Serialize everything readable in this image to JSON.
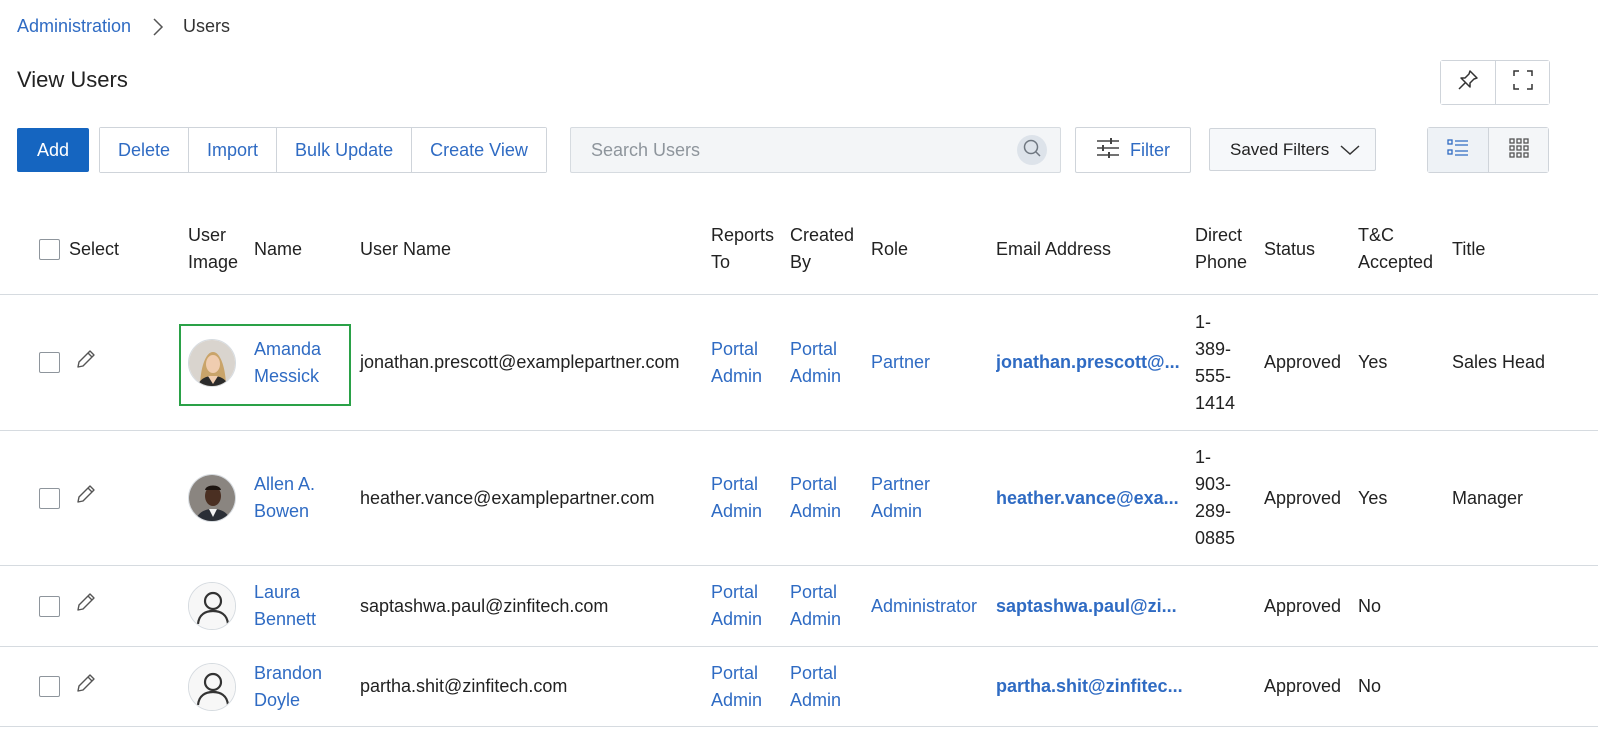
{
  "breadcrumb": {
    "parent": "Administration",
    "current": "Users"
  },
  "page_title": "View Users",
  "toolbar": {
    "add": "Add",
    "delete": "Delete",
    "import": "Import",
    "bulk_update": "Bulk Update",
    "create_view": "Create View",
    "search_placeholder": "Search Users",
    "filter": "Filter",
    "saved_filters": "Saved Filters"
  },
  "columns": {
    "select": "Select",
    "user_image_1": "User",
    "user_image_2": "Image",
    "name": "Name",
    "user_name": "User Name",
    "reports_to_1": "Reports",
    "reports_to_2": "To",
    "created_by_1": "Created",
    "created_by_2": "By",
    "role": "Role",
    "email": "Email Address",
    "direct_phone_1": "Direct",
    "direct_phone_2": "Phone",
    "status": "Status",
    "tc_1": "T&C",
    "tc_2": "Accepted",
    "title": "Title"
  },
  "rows": [
    {
      "first": "Amanda",
      "last": "Messick",
      "username": "jonathan.prescott@examplepartner.com",
      "reports_1": "Portal",
      "reports_2": "Admin",
      "created_1": "Portal",
      "created_2": "Admin",
      "role_1": "Partner",
      "role_2": "",
      "email": "jonathan.prescott@...",
      "phone_1": "1-",
      "phone_2": "389-",
      "phone_3": "555-",
      "phone_4": "1414",
      "status": "Approved",
      "tc": "Yes",
      "title": "Sales Head",
      "avatar": "photo-woman"
    },
    {
      "first": "Allen A.",
      "last": "Bowen",
      "username": "heather.vance@examplepartner.com",
      "reports_1": "Portal",
      "reports_2": "Admin",
      "created_1": "Portal",
      "created_2": "Admin",
      "role_1": "Partner",
      "role_2": "Admin",
      "email": "heather.vance@exa...",
      "phone_1": "1-",
      "phone_2": "903-",
      "phone_3": "289-",
      "phone_4": "0885",
      "status": "Approved",
      "tc": "Yes",
      "title": "Manager",
      "avatar": "photo-man"
    },
    {
      "first": "Laura",
      "last": "Bennett",
      "username": "saptashwa.paul@zinfitech.com",
      "reports_1": "Portal",
      "reports_2": "Admin",
      "created_1": "Portal",
      "created_2": "Admin",
      "role_1": "Administrator",
      "role_2": "",
      "email": "saptashwa.paul@zi...",
      "status": "Approved",
      "tc": "No",
      "title": "",
      "avatar": "default-user-icon"
    },
    {
      "first": "Brandon",
      "last": "Doyle",
      "username": "partha.shit@zinfitech.com",
      "reports_1": "Portal",
      "reports_2": "Admin",
      "created_1": "Portal",
      "created_2": "Admin",
      "role_1": "",
      "role_2": "",
      "email": "partha.shit@zinfitec...",
      "status": "Approved",
      "tc": "No",
      "title": "",
      "avatar": "default-user-icon"
    }
  ],
  "colors": {
    "link": "#2f6bc3",
    "primary": "#1565c0",
    "highlight": "#2aa147"
  }
}
